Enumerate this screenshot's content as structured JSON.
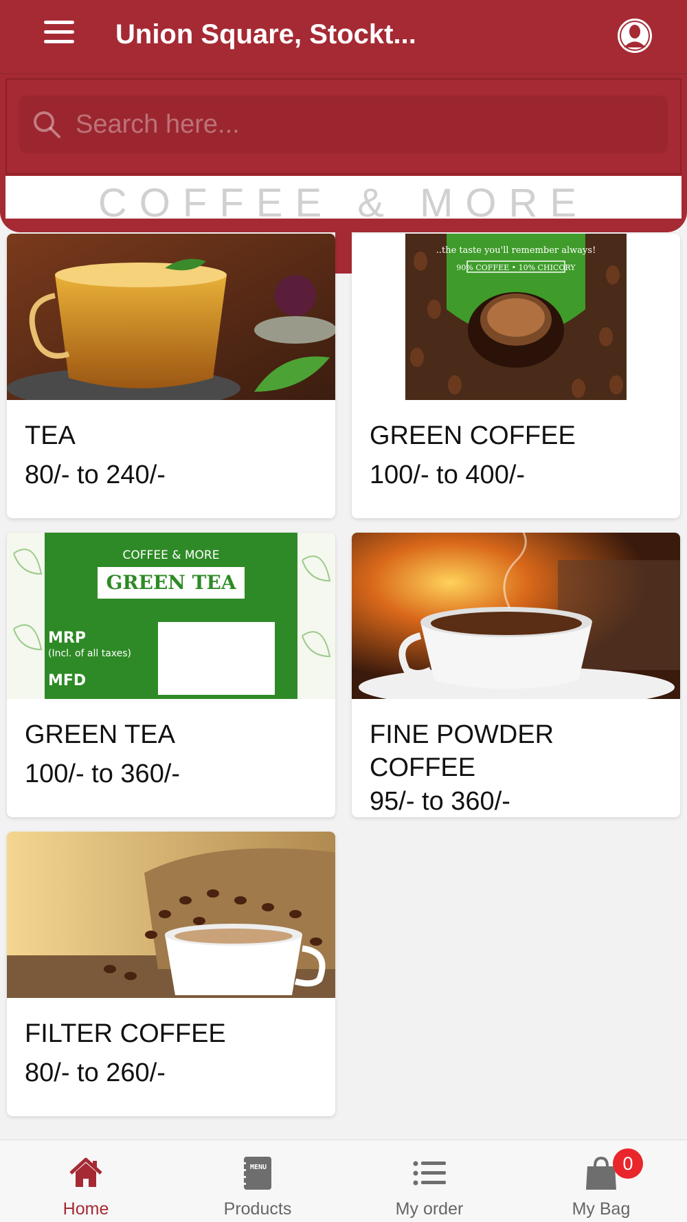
{
  "header": {
    "title": "Union Square, Stockt...",
    "menu_icon": "hamburger-menu-icon",
    "profile_icon": "user-profile-icon",
    "background_color": "#a52a34"
  },
  "search": {
    "placeholder": "Search here...",
    "value": ""
  },
  "banner": {
    "tagline": "COFFEE & MORE"
  },
  "products": [
    {
      "name": "TEA",
      "price": "80/- to 240/-",
      "image": "tea-cup-photo"
    },
    {
      "name": "GREEN COFFEE",
      "price": "100/- to 400/-",
      "image": "green-coffee-pack-photo"
    },
    {
      "name": "GREEN TEA",
      "price": "100/- to 360/-",
      "image": "green-tea-label-photo"
    },
    {
      "name": "FINE POWDER COFFEE",
      "price": "95/- to 360/-",
      "image": "coffee-cup-fireplace-photo"
    },
    {
      "name": "FILTER COFFEE",
      "price": "80/- to 260/-",
      "image": "coffee-beans-sack-photo"
    }
  ],
  "bottom_nav": {
    "items": [
      {
        "label": "Home",
        "icon": "home-icon",
        "active": true
      },
      {
        "label": "Products",
        "icon": "menu-book-icon",
        "active": false
      },
      {
        "label": "My order",
        "icon": "list-icon",
        "active": false
      },
      {
        "label": "My Bag",
        "icon": "shopping-bag-icon",
        "active": false
      }
    ],
    "bag_count": "0",
    "active_color": "#a52a34",
    "badge_color": "#e8262c"
  }
}
